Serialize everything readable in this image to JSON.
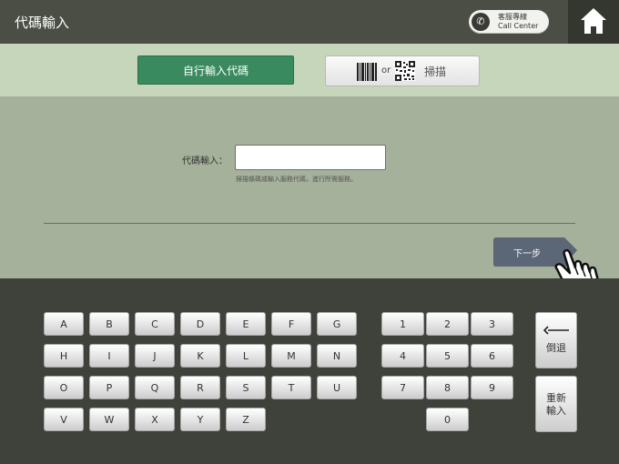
{
  "header": {
    "title": "代碼輸入",
    "call_line1": "客服專線",
    "call_line2": "Call Center"
  },
  "modes": {
    "manual_label": "自行輸入代碼",
    "or_label": "or",
    "scan_label": "掃描"
  },
  "form": {
    "code_label": "代碼輸入：",
    "code_value": "",
    "hint": "掃描條碼或輸入服務代碼，進行所需服務。",
    "next_label": "下一步"
  },
  "keyboard": {
    "letters": [
      [
        "A",
        "B",
        "C",
        "D",
        "E",
        "F",
        "G"
      ],
      [
        "H",
        "I",
        "J",
        "K",
        "L",
        "M",
        "N"
      ],
      [
        "O",
        "P",
        "Q",
        "R",
        "S",
        "T",
        "U"
      ],
      [
        "V",
        "W",
        "X",
        "Y",
        "Z"
      ]
    ],
    "numbers": [
      [
        "1",
        "2",
        "3"
      ],
      [
        "4",
        "5",
        "6"
      ],
      [
        "7",
        "8",
        "9"
      ],
      [
        "0"
      ]
    ],
    "backspace_label": "倒退",
    "reset_label_1": "重新",
    "reset_label_2": "輸入"
  },
  "colors": {
    "header_bg": "#4a4e45",
    "mode_bar_bg": "#c6d6bb",
    "form_bg": "#a5b19a",
    "keyboard_bg": "#3e423a",
    "manual_button": "#3a8a5f",
    "next_button": "#5b6676"
  },
  "icons": {
    "call": "phone-icon",
    "home": "home-icon",
    "barcode": "barcode-icon",
    "qr": "qr-code-icon",
    "next_arrow": "arrow-right-icon",
    "backspace_arrow": "arrow-left-icon",
    "pointer": "hand-pointer-icon"
  }
}
